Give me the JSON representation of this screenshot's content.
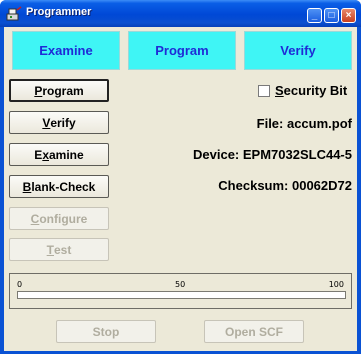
{
  "window": {
    "title": "Programmer",
    "controls": {
      "minimize": "_",
      "maximize": "□",
      "close": "×"
    }
  },
  "mode_tabs": [
    {
      "label": "Examine"
    },
    {
      "label": "Program"
    },
    {
      "label": "Verify"
    }
  ],
  "actions": {
    "program": {
      "prefix": "",
      "accel": "P",
      "suffix": "rogram"
    },
    "verify": {
      "prefix": "",
      "accel": "V",
      "suffix": "erify"
    },
    "examine": {
      "prefix": "E",
      "accel": "x",
      "suffix": "amine"
    },
    "blank_check": {
      "prefix": "",
      "accel": "B",
      "suffix": "lank-Check"
    },
    "configure": {
      "prefix": "",
      "accel": "C",
      "suffix": "onfigure"
    },
    "test": {
      "prefix": "",
      "accel": "T",
      "suffix": "est"
    }
  },
  "security": {
    "label_accel": "S",
    "label_rest": "ecurity Bit",
    "checked": false
  },
  "info": {
    "file": "File: accum.pof",
    "device": "Device: EPM7032SLC44-5",
    "checksum": "Checksum: 00062D72"
  },
  "progress": {
    "ticks": [
      "0",
      "50",
      "100"
    ],
    "value_percent": 0
  },
  "bottom_buttons": {
    "stop": "Stop",
    "open_scf": "Open SCF"
  },
  "colors": {
    "tab_bg": "#3ff5f5",
    "tab_text": "#1f2bd6",
    "titlebar": "#0a52d4",
    "client_bg": "#ece9d8"
  }
}
